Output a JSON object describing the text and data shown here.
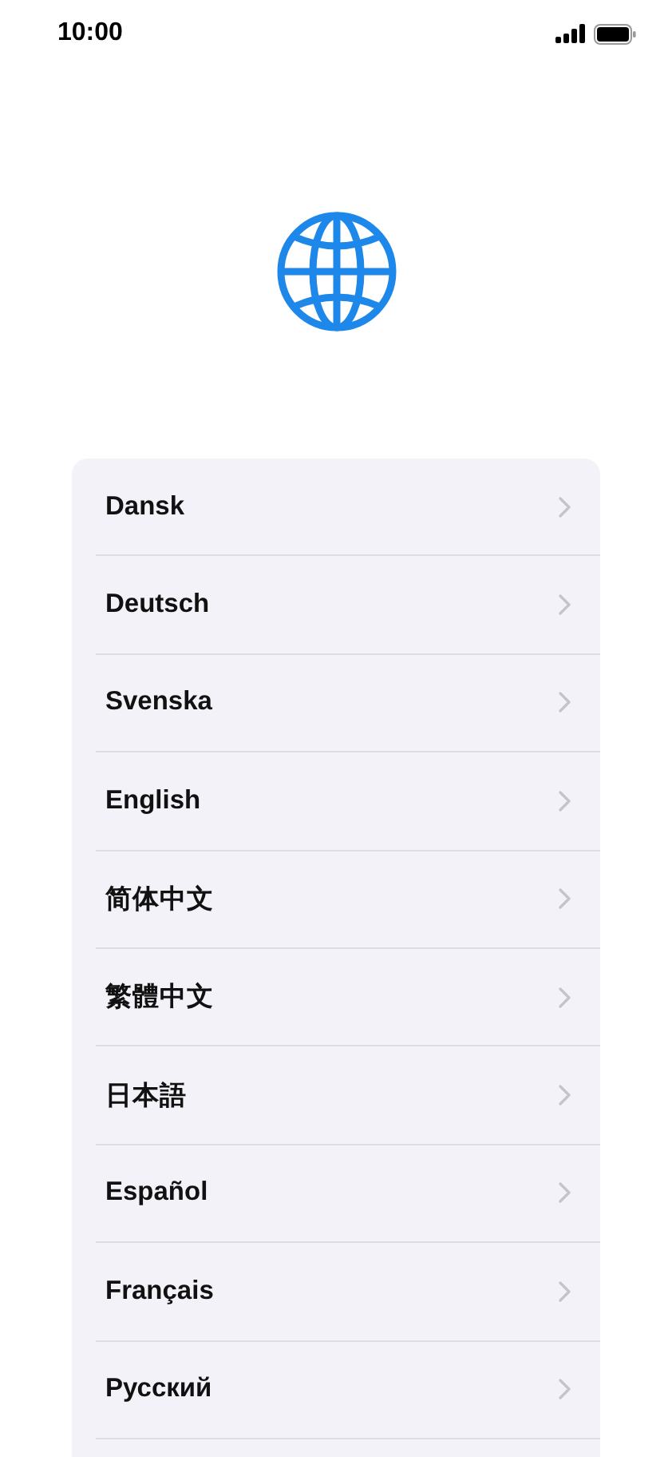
{
  "status_bar": {
    "time": "10:00"
  },
  "languages": [
    {
      "label": "Dansk"
    },
    {
      "label": "Deutsch"
    },
    {
      "label": "Svenska"
    },
    {
      "label": "English"
    },
    {
      "label": "简体中文"
    },
    {
      "label": "繁體中文"
    },
    {
      "label": "日本語"
    },
    {
      "label": "Español"
    },
    {
      "label": "Français"
    },
    {
      "label": "Русский"
    }
  ]
}
